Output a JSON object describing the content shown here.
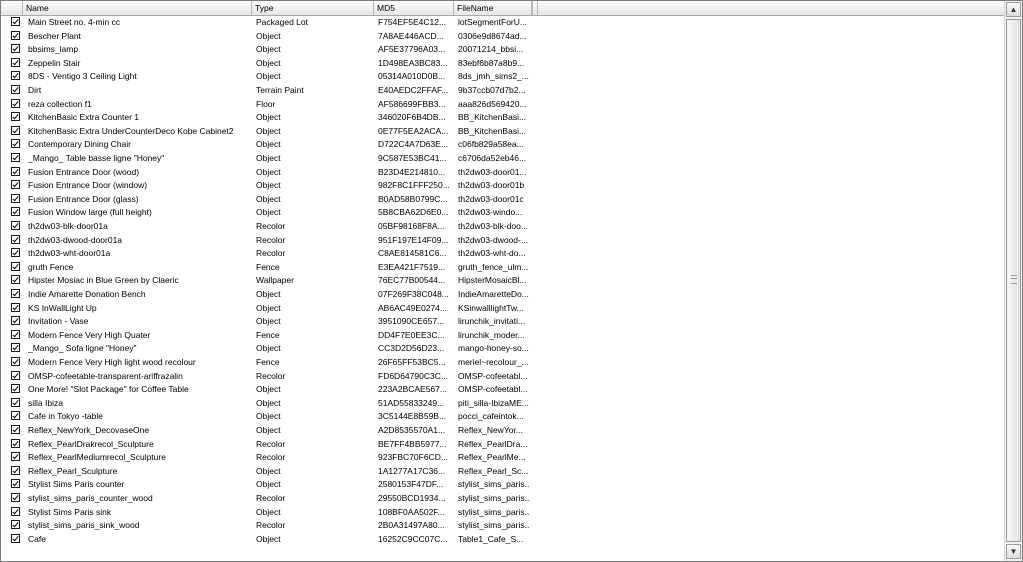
{
  "columns": {
    "name": "Name",
    "type": "Type",
    "md5": "MD5",
    "file": "FileName"
  },
  "rows": [
    {
      "name": "Main Street no. 4-min cc",
      "type": "Packaged Lot",
      "md5": "F754EF5E4C12...",
      "file": "lotSegmentForU..."
    },
    {
      "name": "Bescher Plant",
      "type": "Object",
      "md5": "7A8AE446ACD...",
      "file": "0306e9d8674ad..."
    },
    {
      "name": "bbsims_lamp",
      "type": "Object",
      "md5": "AF5E37796A03...",
      "file": "20071214_bbsi..."
    },
    {
      "name": "Zeppelin Stair",
      "type": "Object",
      "md5": "1D498EA3BC83...",
      "file": "83ebf6b87a8b9..."
    },
    {
      "name": "8DS - Ventigo 3 Ceiling Light",
      "type": "Object",
      "md5": "05314A010D0B...",
      "file": "8ds_jmh_sims2_..."
    },
    {
      "name": "Dirt",
      "type": "Terrain Paint",
      "md5": "E40AEDC2FFAF...",
      "file": "9b37ccb07d7b2..."
    },
    {
      "name": "reza collection f1",
      "type": "Floor",
      "md5": "AF586699FBB3...",
      "file": "aaa826d569420..."
    },
    {
      "name": "KitchenBasic Extra Counter 1",
      "type": "Object",
      "md5": "346020F6B4DB...",
      "file": "BB_KitchenBasi..."
    },
    {
      "name": "KitchenBasic Extra UnderCounterDeco Kobe Cabinet2",
      "type": "Object",
      "md5": "0E77F5EA2ACA...",
      "file": "BB_KitchenBasi..."
    },
    {
      "name": "Contemporary Dining Chair",
      "type": "Object",
      "md5": "D722C4A7D63E...",
      "file": "c06fb829a58ea..."
    },
    {
      "name": "_Mango_ Table basse ligne \"Honey\"",
      "type": "Object",
      "md5": "9C587E53BC41...",
      "file": "c6706da52eb46..."
    },
    {
      "name": "Fusion Entrance Door (wood)",
      "type": "Object",
      "md5": "B23D4E214810...",
      "file": "th2dw03-door01..."
    },
    {
      "name": "Fusion Entrance Door (window)",
      "type": "Object",
      "md5": "982F8C1FFF250...",
      "file": "th2dw03-door01b"
    },
    {
      "name": "Fusion Entrance Door (glass)",
      "type": "Object",
      "md5": "B0AD58B0799C...",
      "file": "th2dw03-door01c"
    },
    {
      "name": "Fusion Window large (full height)",
      "type": "Object",
      "md5": "5B8CBA62D6E0...",
      "file": "th2dw03-windo..."
    },
    {
      "name": "th2dw03-blk-door01a",
      "type": "Recolor",
      "md5": "05BF98168F8A...",
      "file": "th2dw03-blk-doo..."
    },
    {
      "name": "th2dw03-dwood-door01a",
      "type": "Recolor",
      "md5": "951F197E14F09...",
      "file": "th2dw03-dwood-..."
    },
    {
      "name": "th2dw03-wht-door01a",
      "type": "Recolor",
      "md5": "C8AE814581C6...",
      "file": "th2dw03-wht-do..."
    },
    {
      "name": "gruth Fence",
      "type": "Fence",
      "md5": "E3EA421F7519...",
      "file": "gruth_fence_ulm..."
    },
    {
      "name": "Hipster Mosiac in Blue Green by Claeric",
      "type": "Wallpaper",
      "md5": "76EC77B00544...",
      "file": "HipsterMosaicBl..."
    },
    {
      "name": "Indie Amarette Donation Bench",
      "type": "Object",
      "md5": "07F269F38C048...",
      "file": "IndieAmaretteDo..."
    },
    {
      "name": "KS InWallLight Up",
      "type": "Object",
      "md5": "AB6AC49E0274...",
      "file": "KSinwalllightTw..."
    },
    {
      "name": "Invitation - Vase",
      "type": "Object",
      "md5": "3951090CE657...",
      "file": "lirunchik_invitati..."
    },
    {
      "name": "Modern Fence Very High Quater",
      "type": "Fence",
      "md5": "DD4F7E0EE3C...",
      "file": "lirunchik_moder..."
    },
    {
      "name": "_Mango_ Sofa ligne \"Honey\"",
      "type": "Object",
      "md5": "CC3D2D56D23...",
      "file": "mango-honey-so..."
    },
    {
      "name": "Modern Fence Very High light wood recolour",
      "type": "Fence",
      "md5": "26F65FF53BC5...",
      "file": "meriel~recolour_..."
    },
    {
      "name": "OMSP-cofeetable-transparent-ariffrazalin",
      "type": "Recolor",
      "md5": "FD6D64790C3C...",
      "file": "OMSP-cofeetabl..."
    },
    {
      "name": "One More! \"Slot Package\" for Coffee Table",
      "type": "Object",
      "md5": "223A2BCAE567...",
      "file": "OMSP-cofeetabl..."
    },
    {
      "name": "silla Ibiza",
      "type": "Object",
      "md5": "51AD55833249...",
      "file": "piti_silla-IbizaME..."
    },
    {
      "name": "Cafe in Tokyo -table",
      "type": "Object",
      "md5": "3C5144E8B59B...",
      "file": "pocci_cafeintok..."
    },
    {
      "name": "Reflex_NewYork_DecovaseOne",
      "type": "Object",
      "md5": "A2D8535570A1...",
      "file": "Reflex_NewYor..."
    },
    {
      "name": "Reflex_PearlDrakrecol_Sculpture",
      "type": "Recolor",
      "md5": "BE7FF4BB5977...",
      "file": "Reflex_PearlDra..."
    },
    {
      "name": "Reflex_PearlMediumrecol_Sculpture",
      "type": "Recolor",
      "md5": "923FBC70F6CD...",
      "file": "Reflex_PearlMe..."
    },
    {
      "name": "Reflex_Pearl_Sculpture",
      "type": "Object",
      "md5": "1A1277A17C36...",
      "file": "Reflex_Pearl_Sc..."
    },
    {
      "name": "Stylist Sims Paris counter",
      "type": "Object",
      "md5": "2580153F47DF...",
      "file": "stylist_sims_paris..."
    },
    {
      "name": "stylist_sims_paris_counter_wood",
      "type": "Recolor",
      "md5": "29550BCD1934...",
      "file": "stylist_sims_paris..."
    },
    {
      "name": "Stylist Sims Paris sink",
      "type": "Object",
      "md5": "108BF0AA502F...",
      "file": "stylist_sims_paris..."
    },
    {
      "name": "stylist_sims_paris_sink_wood",
      "type": "Recolor",
      "md5": "2B0A31497A80...",
      "file": "stylist_sims_paris..."
    },
    {
      "name": "Cafe",
      "type": "Object",
      "md5": "16252C9CC07C...",
      "file": "Table1_Cafe_S..."
    }
  ],
  "icons": {
    "scroll_up": "arrow-up-icon",
    "scroll_down": "arrow-down-icon",
    "check": "checkmark-icon"
  }
}
